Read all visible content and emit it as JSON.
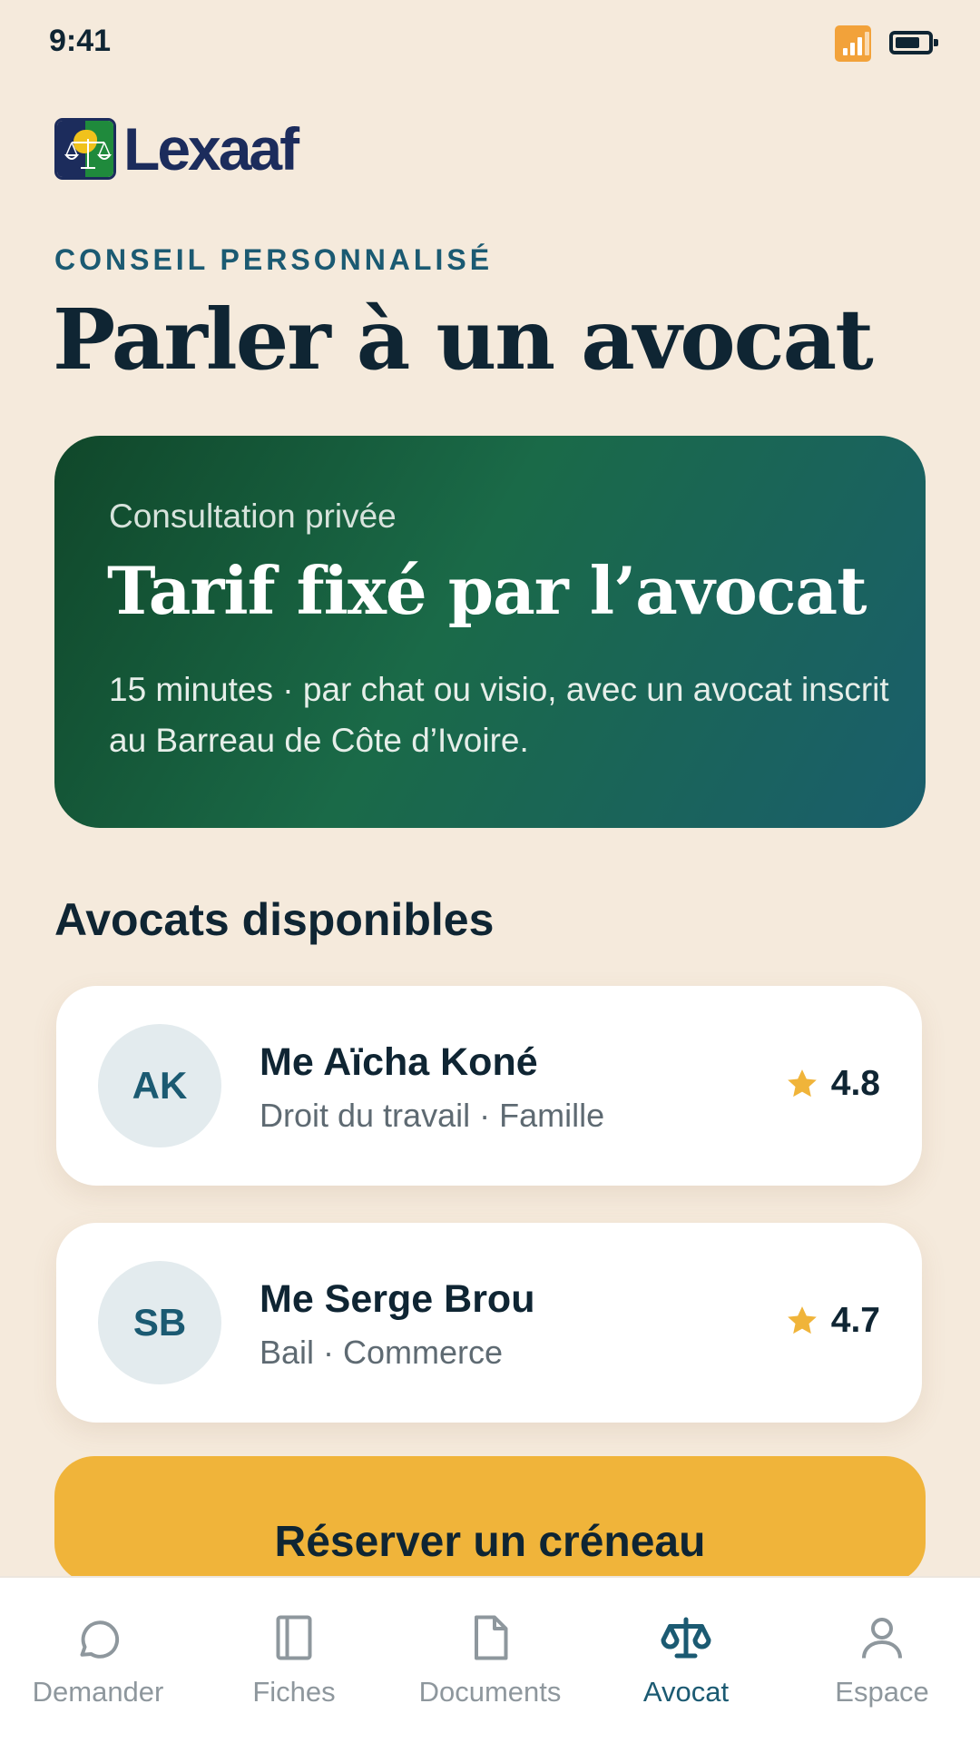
{
  "status_bar": {
    "time": "9:41",
    "icons": [
      "signal-icon",
      "battery-icon"
    ],
    "battery_level": 0.75
  },
  "brand": {
    "name": "Lexaaf",
    "colors": {
      "navy": "#1c2c5c",
      "green": "#1f8a3c",
      "gold": "#f0c21c"
    }
  },
  "header": {
    "eyebrow": "CONSEIL PERSONNALISÉ",
    "title": "Parler à un avocat"
  },
  "hero": {
    "eyebrow": "Consultation privée",
    "title": "Tarif fixé par l’avocat",
    "description": "15 minutes · par chat ou visio, avec un avocat inscrit au Barreau de Côte d’Ivoire."
  },
  "lawyers_section": {
    "title": "Avocats disponibles",
    "items": [
      {
        "initials": "AK",
        "name": "Me Aïcha Koné",
        "specialties": "Droit du travail · Famille",
        "rating": "4.8"
      },
      {
        "initials": "SB",
        "name": "Me Serge Brou",
        "specialties": "Bail · Commerce",
        "rating": "4.7"
      }
    ]
  },
  "cta": {
    "label": "Réserver un créneau"
  },
  "bottom_nav": {
    "items": [
      {
        "label": "Demander",
        "icon": "chat-bubble-icon",
        "active": false
      },
      {
        "label": "Fiches",
        "icon": "book-icon",
        "active": false
      },
      {
        "label": "Documents",
        "icon": "document-icon",
        "active": false
      },
      {
        "label": "Avocat",
        "icon": "scales-icon",
        "active": true
      },
      {
        "label": "Espace",
        "icon": "user-icon",
        "active": false
      }
    ]
  },
  "colors": {
    "background": "#f5eadc",
    "accent_teal": "#1b5a72",
    "cta_yellow": "#f0b43a",
    "star": "#f0b43a",
    "text_dark": "#0f2533"
  }
}
